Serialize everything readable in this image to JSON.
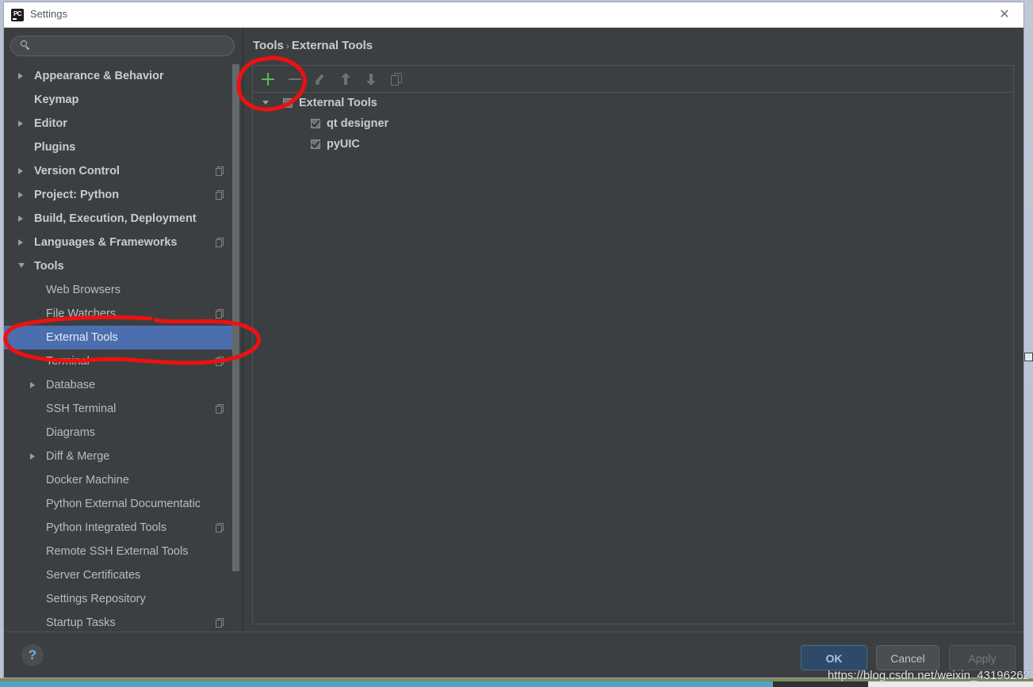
{
  "window": {
    "title": "Settings",
    "app_icon": "pycharm-icon",
    "close_icon": "close-icon"
  },
  "sidebar": {
    "search": {
      "value": "",
      "placeholder": "",
      "icon": "search-icon"
    },
    "items": [
      {
        "label": "Appearance & Behavior",
        "arrow": "closed",
        "indent": 38,
        "bold": true,
        "badge": false,
        "selected": false
      },
      {
        "label": "Keymap",
        "arrow": "none",
        "indent": 38,
        "bold": true,
        "badge": false,
        "selected": false
      },
      {
        "label": "Editor",
        "arrow": "closed",
        "indent": 38,
        "bold": true,
        "badge": false,
        "selected": false
      },
      {
        "label": "Plugins",
        "arrow": "none",
        "indent": 38,
        "bold": true,
        "badge": false,
        "selected": false
      },
      {
        "label": "Version Control",
        "arrow": "closed",
        "indent": 38,
        "bold": true,
        "badge": true,
        "selected": false
      },
      {
        "label": "Project: Python",
        "arrow": "closed",
        "indent": 38,
        "bold": true,
        "badge": true,
        "selected": false
      },
      {
        "label": "Build, Execution, Deployment",
        "arrow": "closed",
        "indent": 38,
        "bold": true,
        "badge": false,
        "selected": false
      },
      {
        "label": "Languages & Frameworks",
        "arrow": "closed",
        "indent": 38,
        "bold": true,
        "badge": true,
        "selected": false
      },
      {
        "label": "Tools",
        "arrow": "open",
        "indent": 38,
        "bold": true,
        "badge": false,
        "selected": false
      },
      {
        "label": "Web Browsers",
        "arrow": "none",
        "indent": 53,
        "bold": false,
        "badge": false,
        "selected": false
      },
      {
        "label": "File Watchers",
        "arrow": "none",
        "indent": 53,
        "bold": false,
        "badge": true,
        "selected": false
      },
      {
        "label": "External Tools",
        "arrow": "none",
        "indent": 53,
        "bold": false,
        "badge": false,
        "selected": true
      },
      {
        "label": "Terminal",
        "arrow": "none",
        "indent": 53,
        "bold": false,
        "badge": true,
        "selected": false
      },
      {
        "label": "Database",
        "arrow": "closed",
        "indent": 53,
        "bold": false,
        "badge": false,
        "selected": false
      },
      {
        "label": "SSH Terminal",
        "arrow": "none",
        "indent": 53,
        "bold": false,
        "badge": true,
        "selected": false
      },
      {
        "label": "Diagrams",
        "arrow": "none",
        "indent": 53,
        "bold": false,
        "badge": false,
        "selected": false
      },
      {
        "label": "Diff & Merge",
        "arrow": "closed",
        "indent": 53,
        "bold": false,
        "badge": false,
        "selected": false
      },
      {
        "label": "Docker Machine",
        "arrow": "none",
        "indent": 53,
        "bold": false,
        "badge": false,
        "selected": false
      },
      {
        "label": "Python External Documentatic",
        "arrow": "none",
        "indent": 53,
        "bold": false,
        "badge": false,
        "selected": false
      },
      {
        "label": "Python Integrated Tools",
        "arrow": "none",
        "indent": 53,
        "bold": false,
        "badge": true,
        "selected": false
      },
      {
        "label": "Remote SSH External Tools",
        "arrow": "none",
        "indent": 53,
        "bold": false,
        "badge": false,
        "selected": false
      },
      {
        "label": "Server Certificates",
        "arrow": "none",
        "indent": 53,
        "bold": false,
        "badge": false,
        "selected": false
      },
      {
        "label": "Settings Repository",
        "arrow": "none",
        "indent": 53,
        "bold": false,
        "badge": false,
        "selected": false
      },
      {
        "label": "Startup Tasks",
        "arrow": "none",
        "indent": 53,
        "bold": false,
        "badge": true,
        "selected": false
      }
    ]
  },
  "main": {
    "breadcrumb": {
      "parent": "Tools",
      "separator": "›",
      "current": "External Tools"
    },
    "toolbar": [
      {
        "name": "add-button",
        "icon": "plus-icon",
        "enabled": true,
        "color": "#5cb85c"
      },
      {
        "name": "remove-button",
        "icon": "minus-icon",
        "enabled": false,
        "color": "#6d7275"
      },
      {
        "name": "edit-button",
        "icon": "pencil-icon",
        "enabled": false,
        "color": "#6d7275"
      },
      {
        "name": "move-up-button",
        "icon": "arrow-up-icon",
        "enabled": false,
        "color": "#6d7275"
      },
      {
        "name": "move-down-button",
        "icon": "arrow-down-icon",
        "enabled": false,
        "color": "#6d7275"
      },
      {
        "name": "copy-button",
        "icon": "copy-icon",
        "enabled": false,
        "color": "#6d7275"
      }
    ],
    "tree": [
      {
        "label": "External Tools",
        "checked": true,
        "expanded": true,
        "level": 0
      },
      {
        "label": "qt designer",
        "checked": true,
        "expanded": null,
        "level": 1
      },
      {
        "label": "pyUIC",
        "checked": true,
        "expanded": null,
        "level": 1
      }
    ]
  },
  "footer": {
    "help_label": "?",
    "ok_label": "OK",
    "cancel_label": "Cancel",
    "apply_label": "Apply"
  },
  "watermark": {
    "text": "https://blog.csdn.net/weixin_43196262"
  },
  "colors": {
    "window_bg": "#3c3f41",
    "selection_blue": "#4b6eaf",
    "accent_green": "#5cb85c",
    "annotation_red": "#ee1111",
    "ok_blue_text": "#9fc7e8"
  }
}
